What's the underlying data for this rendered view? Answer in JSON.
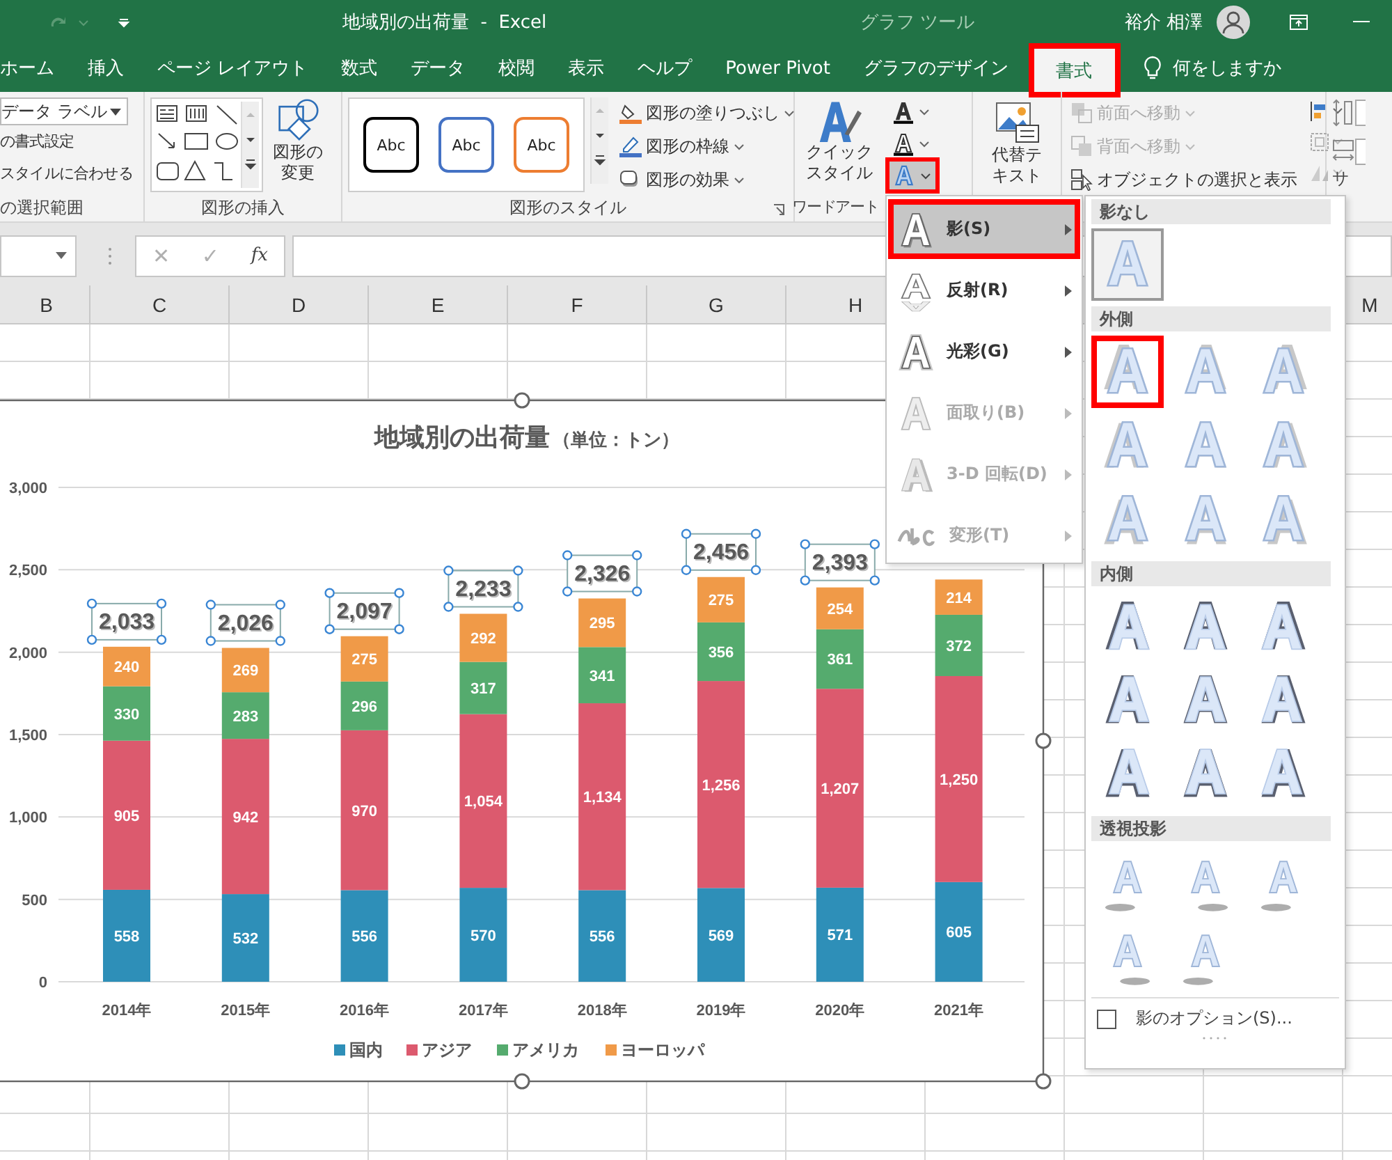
{
  "title_bar": {
    "title": "地域別の出荷量  -  Excel",
    "context_label": "グラフ ツール",
    "user": "裕介 相澤"
  },
  "tabs": [
    {
      "label": "ホーム",
      "selected": false,
      "highlighted": false
    },
    {
      "label": "挿入",
      "selected": false,
      "highlighted": false
    },
    {
      "label": "ページ レイアウト",
      "selected": false,
      "highlighted": false
    },
    {
      "label": "数式",
      "selected": false,
      "highlighted": false
    },
    {
      "label": "データ",
      "selected": false,
      "highlighted": false
    },
    {
      "label": "校閲",
      "selected": false,
      "highlighted": false
    },
    {
      "label": "表示",
      "selected": false,
      "highlighted": false
    },
    {
      "label": "ヘルプ",
      "selected": false,
      "highlighted": false
    },
    {
      "label": "Power Pivot",
      "selected": false,
      "highlighted": false
    },
    {
      "label": "グラフのデザイン",
      "selected": false,
      "highlighted": false
    },
    {
      "label": "書式",
      "selected": true,
      "highlighted": true
    }
  ],
  "tell_me": "何をしますか",
  "ribbon": {
    "selection": {
      "dropdown": "データ ラベル",
      "items": [
        "の書式設定",
        "スタイルに合わせる"
      ],
      "label": "の選択範囲"
    },
    "insert_shapes": {
      "change_shape": "図形の変更",
      "label": "図形の挿入"
    },
    "shape_styles": {
      "swatches": [
        {
          "label": "Abc",
          "color": "#000000"
        },
        {
          "label": "Abc",
          "color": "#4472c4"
        },
        {
          "label": "Abc",
          "color": "#ed7d31"
        }
      ],
      "commands": [
        {
          "label": "図形の塗りつぶし",
          "kind": "fill"
        },
        {
          "label": "図形の枠線",
          "kind": "outline"
        },
        {
          "label": "図形の効果",
          "kind": "effects"
        }
      ],
      "label": "図形のスタイル"
    },
    "wordart": {
      "quick_style": "クイックスタイル",
      "effects_highlighted": true,
      "label": "ワードアート"
    },
    "alt_text": "代替テキスト",
    "arrange": [
      {
        "label": "前面へ移動",
        "disabled": true,
        "kind": "forward"
      },
      {
        "label": "背面へ移動",
        "disabled": true,
        "kind": "backward"
      },
      {
        "label": "オブジェクトの選択と表示",
        "disabled": false,
        "kind": "pane"
      }
    ],
    "size_label": "サ"
  },
  "formula_bar": {
    "cancel": "✕",
    "enter": "✓",
    "function": "fx"
  },
  "columns": [
    "B",
    "C",
    "D",
    "E",
    "F",
    "G",
    "H",
    "M"
  ],
  "chart": {
    "title": "地域別の出荷量",
    "title_note": "（単位：トン）",
    "chart_data": {
      "type": "bar",
      "stacked": true,
      "grid": true,
      "legend": "bottom",
      "categories": [
        "2014年",
        "2015年",
        "2016年",
        "2017年",
        "2018年",
        "2019年",
        "2020年",
        "2021年"
      ],
      "series": [
        {
          "name": "国内",
          "color": "#2e8fb8",
          "values": [
            558,
            532,
            556,
            570,
            556,
            569,
            571,
            605
          ],
          "value_labels": [
            "558",
            "532",
            "556",
            "570",
            "556",
            "569",
            "571",
            "605"
          ]
        },
        {
          "name": "アジア",
          "color": "#dc5a6e",
          "values": [
            905,
            942,
            970,
            1054,
            1134,
            1256,
            1207,
            1250
          ],
          "value_labels": [
            "905",
            "942",
            "970",
            "1,054",
            "1,134",
            "1,256",
            "1,207",
            "1,250"
          ]
        },
        {
          "name": "アメリカ",
          "color": "#55ab6e",
          "values": [
            330,
            283,
            296,
            317,
            341,
            356,
            361,
            372
          ],
          "value_labels": [
            "330",
            "283",
            "296",
            "317",
            "341",
            "356",
            "361",
            "372"
          ]
        },
        {
          "name": "ヨーロッパ",
          "color": "#f09a48",
          "values": [
            240,
            269,
            275,
            292,
            295,
            275,
            254,
            214
          ],
          "value_labels": [
            "240",
            "269",
            "275",
            "292",
            "295",
            "275",
            "254",
            "214"
          ]
        }
      ],
      "ylim": [
        0,
        3000
      ],
      "yticks": [
        {
          "value": 0,
          "label": "0"
        },
        {
          "value": 500,
          "label": "500"
        },
        {
          "value": 1000,
          "label": "1,000"
        },
        {
          "value": 1500,
          "label": "1,500"
        },
        {
          "value": 2000,
          "label": "2,000"
        },
        {
          "value": 2500,
          "label": "2,500"
        },
        {
          "value": 3000,
          "label": "3,000"
        }
      ],
      "annotations": [
        {
          "x": "2014年",
          "y": 2033,
          "text": "2,033"
        },
        {
          "x": "2015年",
          "y": 2026,
          "text": "2,026"
        },
        {
          "x": "2016年",
          "y": 2097,
          "text": "2,097"
        },
        {
          "x": "2017年",
          "y": 2233,
          "text": "2,233"
        },
        {
          "x": "2018年",
          "y": 2326,
          "text": "2,326"
        },
        {
          "x": "2019年",
          "y": 2456,
          "text": "2,456"
        },
        {
          "x": "2020年",
          "y": 2393,
          "text": "2,393"
        }
      ]
    }
  },
  "menu": [
    {
      "label": "影(S)",
      "kind": "shadow",
      "selected": true,
      "disabled": false
    },
    {
      "label": "反射(R)",
      "kind": "reflection",
      "selected": false,
      "disabled": false
    },
    {
      "label": "光彩(G)",
      "kind": "glow",
      "selected": false,
      "disabled": false
    },
    {
      "label": "面取り(B)",
      "kind": "bevel",
      "selected": false,
      "disabled": true
    },
    {
      "label": "3-D 回転(D)",
      "kind": "rotation",
      "selected": false,
      "disabled": true
    },
    {
      "label": "変形(T)",
      "kind": "transform",
      "selected": false,
      "disabled": true
    }
  ],
  "gallery": {
    "sections": [
      {
        "title": "影なし",
        "kind": "none",
        "items": [
          {
            "selected": true,
            "highlighted": false
          }
        ]
      },
      {
        "title": "外側",
        "kind": "outer",
        "items": [
          {
            "selected": false,
            "highlighted": true
          },
          {
            "selected": false,
            "highlighted": false
          },
          {
            "selected": false,
            "highlighted": false
          },
          {
            "selected": false,
            "highlighted": false
          },
          {
            "selected": false,
            "highlighted": false
          },
          {
            "selected": false,
            "highlighted": false
          },
          {
            "selected": false,
            "highlighted": false
          },
          {
            "selected": false,
            "highlighted": false
          },
          {
            "selected": false,
            "highlighted": false
          }
        ]
      },
      {
        "title": "内側",
        "kind": "inner",
        "items": [
          {
            "selected": false,
            "highlighted": false
          },
          {
            "selected": false,
            "highlighted": false
          },
          {
            "selected": false,
            "highlighted": false
          },
          {
            "selected": false,
            "highlighted": false
          },
          {
            "selected": false,
            "highlighted": false
          },
          {
            "selected": false,
            "highlighted": false
          },
          {
            "selected": false,
            "highlighted": false
          },
          {
            "selected": false,
            "highlighted": false
          },
          {
            "selected": false,
            "highlighted": false
          }
        ]
      },
      {
        "title": "透視投影",
        "kind": "perspective",
        "items": [
          {
            "selected": false,
            "highlighted": false
          },
          {
            "selected": false,
            "highlighted": false
          },
          {
            "selected": false,
            "highlighted": false
          },
          {
            "selected": false,
            "highlighted": false
          },
          {
            "selected": false,
            "highlighted": false
          }
        ]
      }
    ],
    "option": {
      "label": "影のオプション(S)...",
      "checked": false
    }
  }
}
